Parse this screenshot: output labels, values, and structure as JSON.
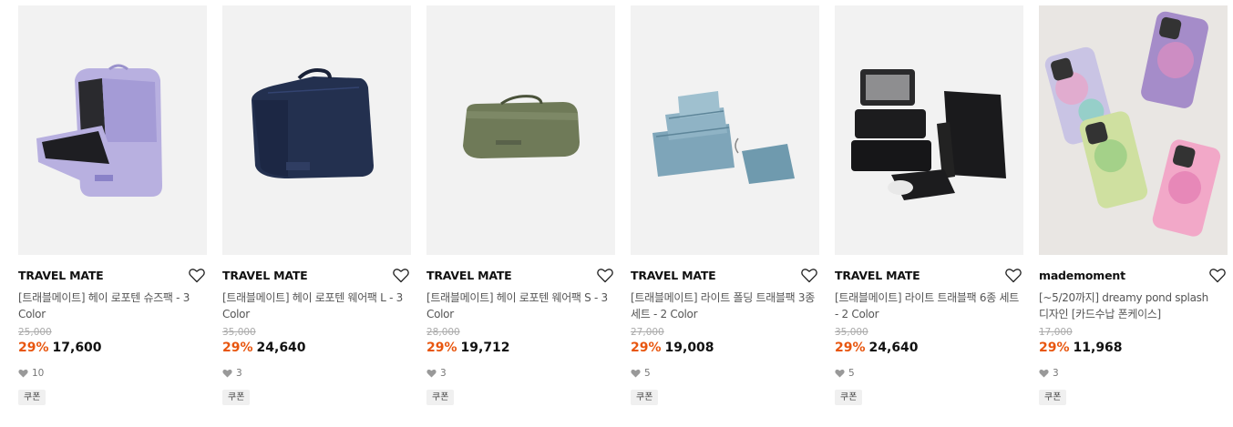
{
  "products": [
    {
      "brand": "TRAVEL MATE",
      "title": "[트래블메이트] 헤이 로포텐 슈즈팩 - 3 Color",
      "original_price": "25,000",
      "discount": "29%",
      "price": "17,600",
      "likes": "10",
      "coupon": "쿠폰",
      "image": "lavender-shoe-pack"
    },
    {
      "brand": "TRAVEL MATE",
      "title": "[트래블메이트] 헤이 로포텐 웨어팩 L - 3 Color",
      "original_price": "35,000",
      "discount": "29%",
      "price": "24,640",
      "likes": "3",
      "coupon": "쿠폰",
      "image": "navy-wear-pack"
    },
    {
      "brand": "TRAVEL MATE",
      "title": "[트래블메이트] 헤이 로포텐 웨어팩 S - 3 Color",
      "original_price": "28,000",
      "discount": "29%",
      "price": "19,712",
      "likes": "3",
      "coupon": "쿠폰",
      "image": "olive-wear-pack"
    },
    {
      "brand": "TRAVEL MATE",
      "title": "[트래블메이트] 라이트 폴딩 트래블팩 3종 세트 - 2 Color",
      "original_price": "27,000",
      "discount": "29%",
      "price": "19,008",
      "likes": "5",
      "coupon": "쿠폰",
      "image": "teal-folding-set"
    },
    {
      "brand": "TRAVEL MATE",
      "title": "[트래블메이트] 라이트 트래블팩 6종 세트 - 2 Color",
      "original_price": "35,000",
      "discount": "29%",
      "price": "24,640",
      "likes": "5",
      "coupon": "쿠폰",
      "image": "black-pack-set"
    },
    {
      "brand": "mademoment",
      "title": "[~5/20까지] dreamy pond splash 디자인 [카드수납 폰케이스]",
      "original_price": "17,000",
      "discount": "29%",
      "price": "11,968",
      "likes": "3",
      "coupon": "쿠폰",
      "image": "floral-phone-cases"
    }
  ],
  "colors": {
    "discount": "#e8560f",
    "thumb_bg": "#f2f2f2"
  }
}
